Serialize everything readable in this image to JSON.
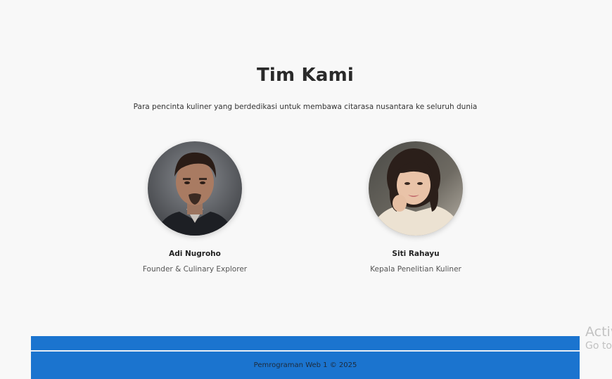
{
  "team": {
    "title": "Tim Kami",
    "subtitle": "Para pencinta kuliner yang berdedikasi untuk membawa citarasa nusantara ke seluruh dunia",
    "members": [
      {
        "name": "Adi Nugroho",
        "role": "Founder & Culinary Explorer",
        "photo": "man-portrait-photo"
      },
      {
        "name": "Siti Rahayu",
        "role": "Kepala Penelitian Kuliner",
        "photo": "woman-portrait-photo"
      }
    ]
  },
  "footer": {
    "text": "Pemrograman Web 1 © 2025",
    "color": "#1b74cf"
  },
  "overlay": {
    "line1": "Activ",
    "line2": "Go to"
  }
}
